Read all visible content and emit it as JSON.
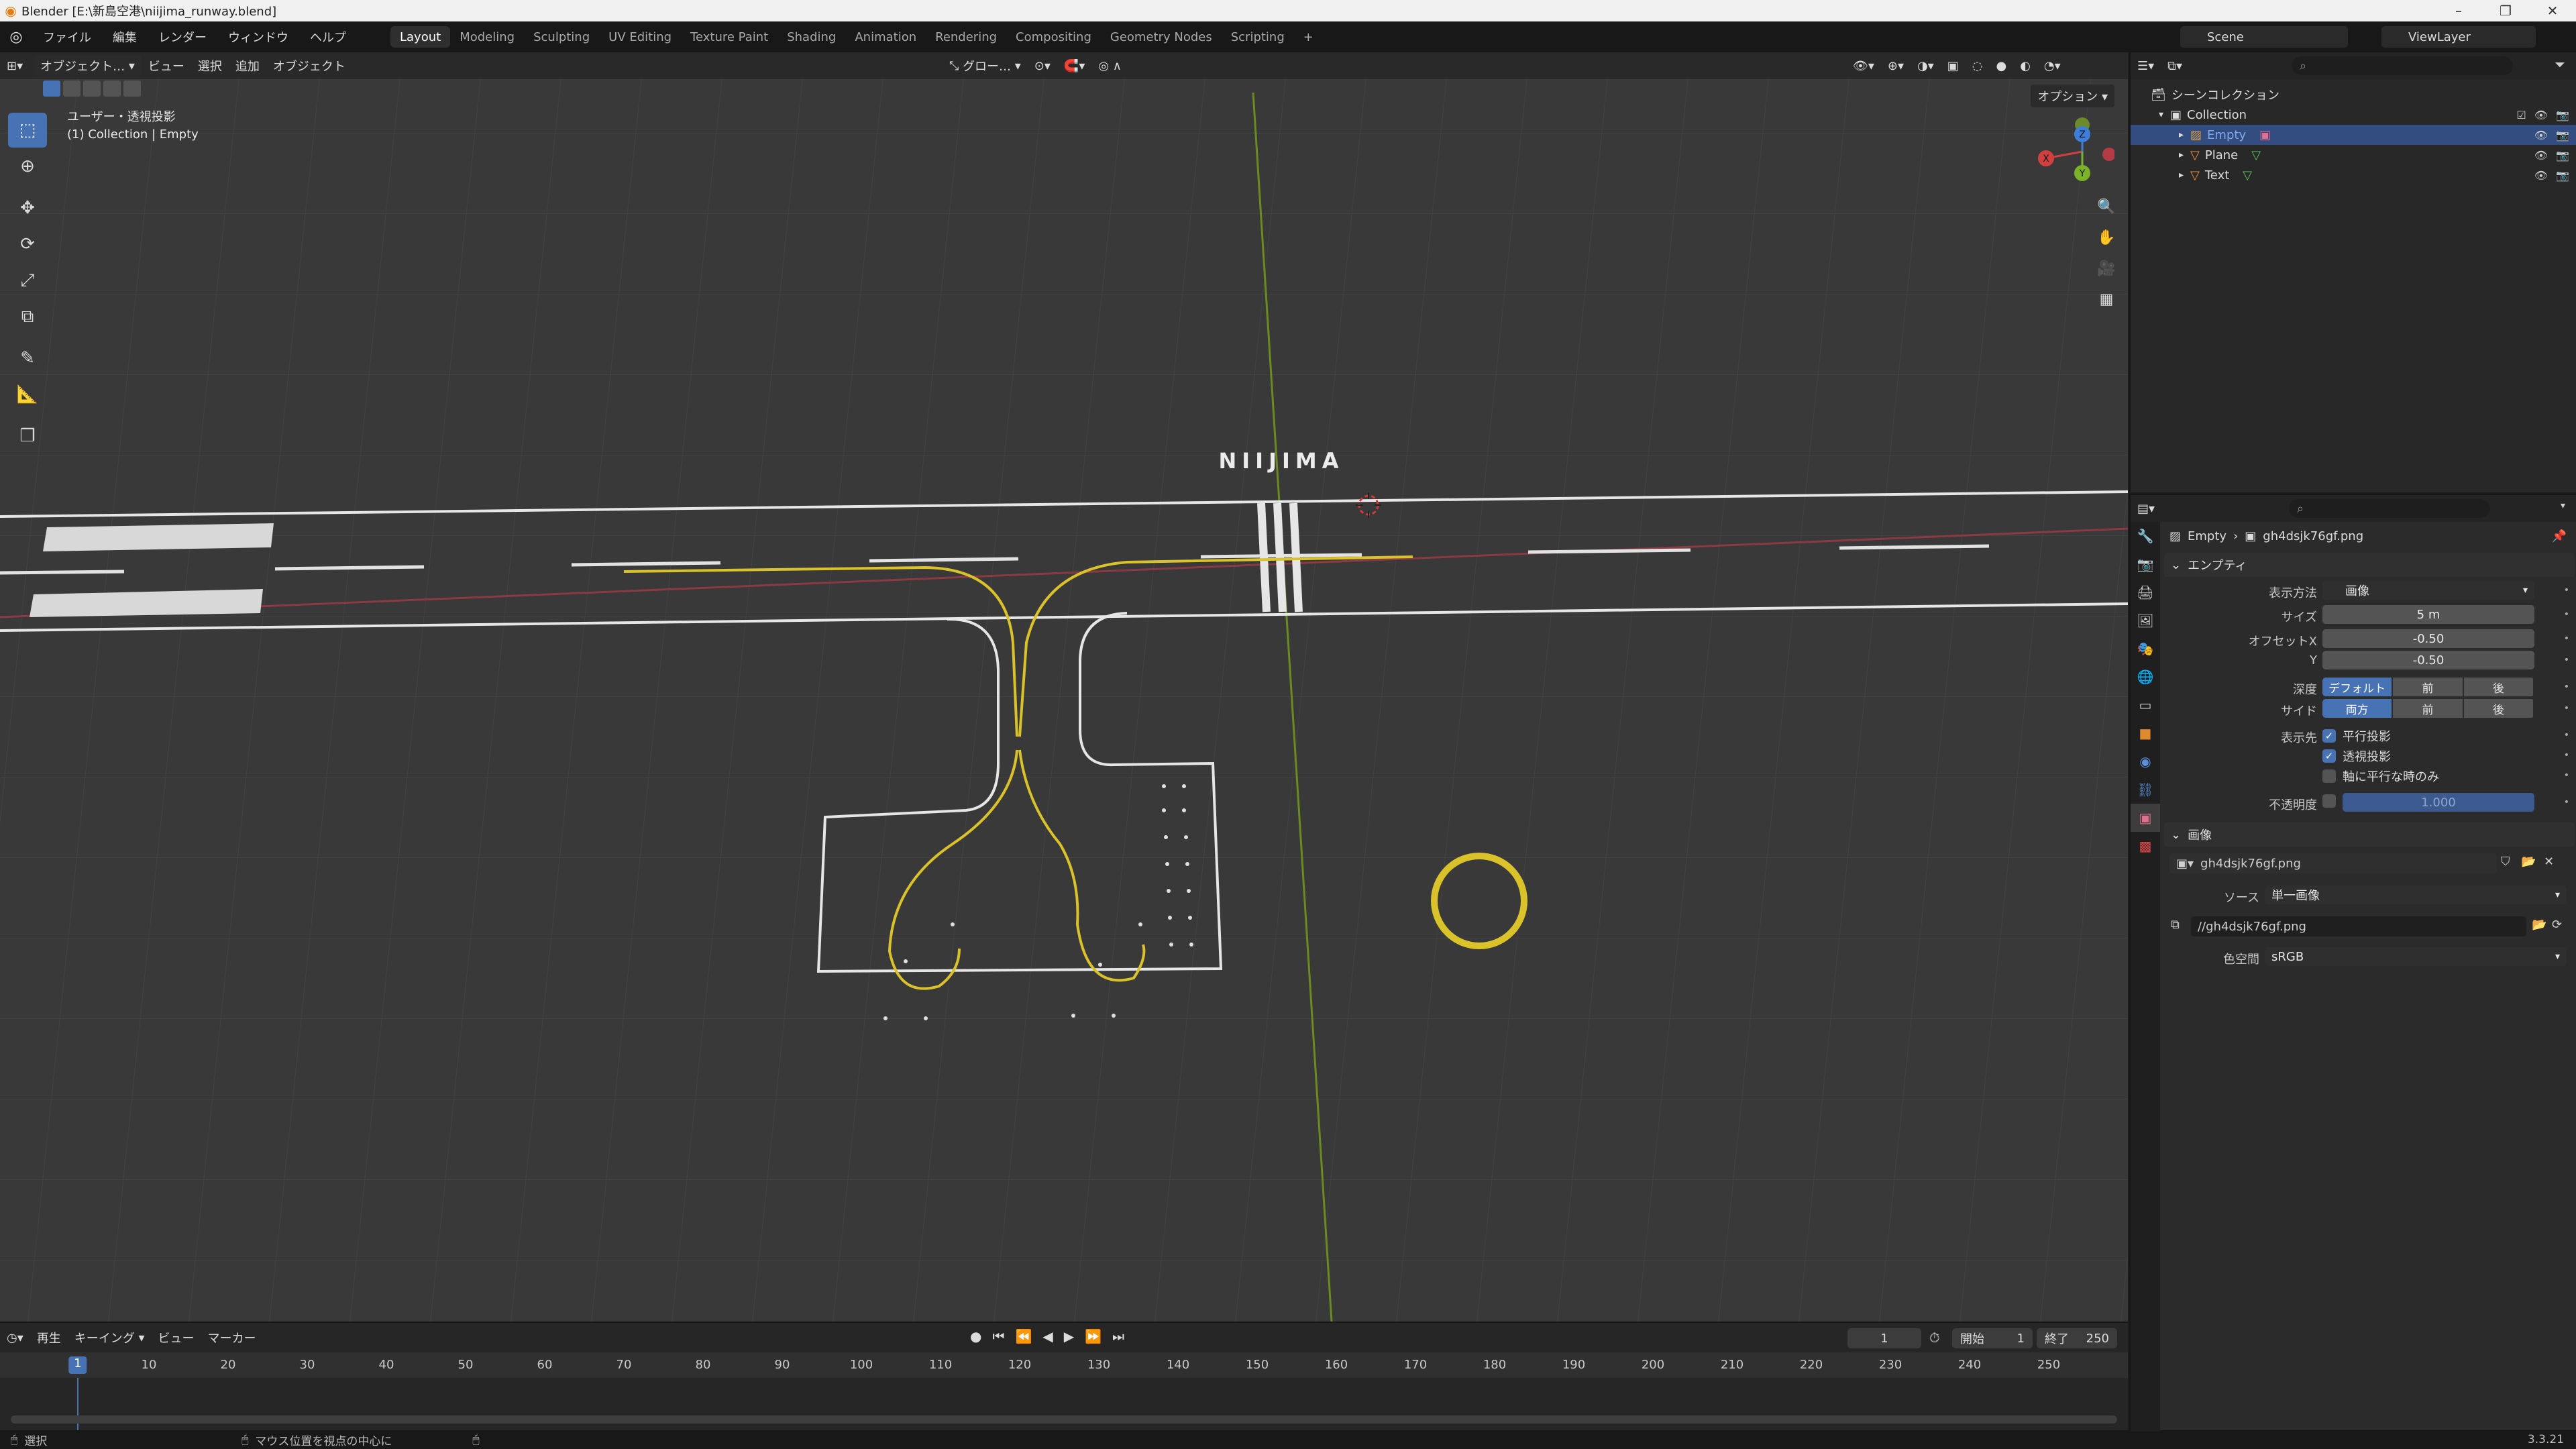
{
  "window": {
    "title": "Blender [E:\\新島空港\\niijima_runway.blend]",
    "controls": [
      "–",
      "❐",
      "✕"
    ]
  },
  "menubar": {
    "items": [
      "ファイル",
      "編集",
      "レンダー",
      "ウィンドウ",
      "ヘルプ"
    ],
    "workspaces": [
      "Layout",
      "Modeling",
      "Sculpting",
      "UV Editing",
      "Texture Paint",
      "Shading",
      "Animation",
      "Rendering",
      "Compositing",
      "Geometry Nodes",
      "Scripting"
    ],
    "active_workspace": "Layout",
    "add_tab": "+",
    "scene": "Scene",
    "view_layer": "ViewLayer"
  },
  "viewport": {
    "mode": "オブジェクト…",
    "menus": [
      "ビュー",
      "選択",
      "追加",
      "オブジェクト"
    ],
    "transform_orientation": "グロー…",
    "options": "オプション",
    "info_line1": "ユーザー・透視投影",
    "info_line2": "(1) Collection | Empty",
    "scene_text": "NIIJIMA",
    "colors": {
      "background": "#393939",
      "accent": "#4772b3",
      "selection_yellow": "#d9c22a"
    },
    "tools": [
      "select-box-icon",
      "cursor-icon",
      "move-icon",
      "rotate-icon",
      "scale-icon",
      "transform-icon",
      "annotate-icon",
      "measure-icon",
      "add-cube-icon"
    ]
  },
  "timeline": {
    "menus": [
      "再生",
      "キーイング",
      "ビュー",
      "マーカー"
    ],
    "current_frame": "1",
    "start_label": "開始",
    "start": "1",
    "end_label": "終了",
    "end": "250",
    "ticks": [
      "10",
      "20",
      "30",
      "40",
      "50",
      "60",
      "70",
      "80",
      "90",
      "100",
      "110",
      "120",
      "130",
      "140",
      "150",
      "160",
      "170",
      "180",
      "190",
      "200",
      "210",
      "220",
      "230",
      "240",
      "250"
    ]
  },
  "statusbar": {
    "select": "選択",
    "center": "マウス位置を視点の中心に",
    "version": "3.3.21"
  },
  "outliner": {
    "scene_collection": "シーンコレクション",
    "items": [
      {
        "name": "Collection",
        "depth": 1
      },
      {
        "name": "Empty",
        "depth": 2,
        "selected": true
      },
      {
        "name": "Plane",
        "depth": 2
      },
      {
        "name": "Text",
        "depth": 2
      }
    ]
  },
  "properties": {
    "breadcrumb_object": "Empty",
    "breadcrumb_data": "gh4dsjk76gf.png",
    "empty_panel": "エンプティ",
    "display_as_label": "表示方法",
    "display_as_value": "画像",
    "size_label": "サイズ",
    "size_value": "5 m",
    "offset_x_label": "オフセットX",
    "offset_x_value": "-0.50",
    "offset_y_label": "Y",
    "offset_y_value": "-0.50",
    "depth_label": "深度",
    "depth_options": [
      "デフォルト",
      "前",
      "後"
    ],
    "side_label": "サイド",
    "side_options": [
      "両方",
      "前",
      "後"
    ],
    "show_in_label": "表示先",
    "show_ortho": "平行投影",
    "show_persp": "透視投影",
    "show_axis_aligned": "軸に平行な時のみ",
    "opacity_label": "不透明度",
    "opacity_value": "1.000",
    "image_panel": "画像",
    "image_name": "gh4dsjk76gf.png",
    "source_label": "ソース",
    "source_value": "単一画像",
    "filepath": "//gh4dsjk76gf.png",
    "colorspace_label": "色空間",
    "colorspace_value": "sRGB"
  }
}
